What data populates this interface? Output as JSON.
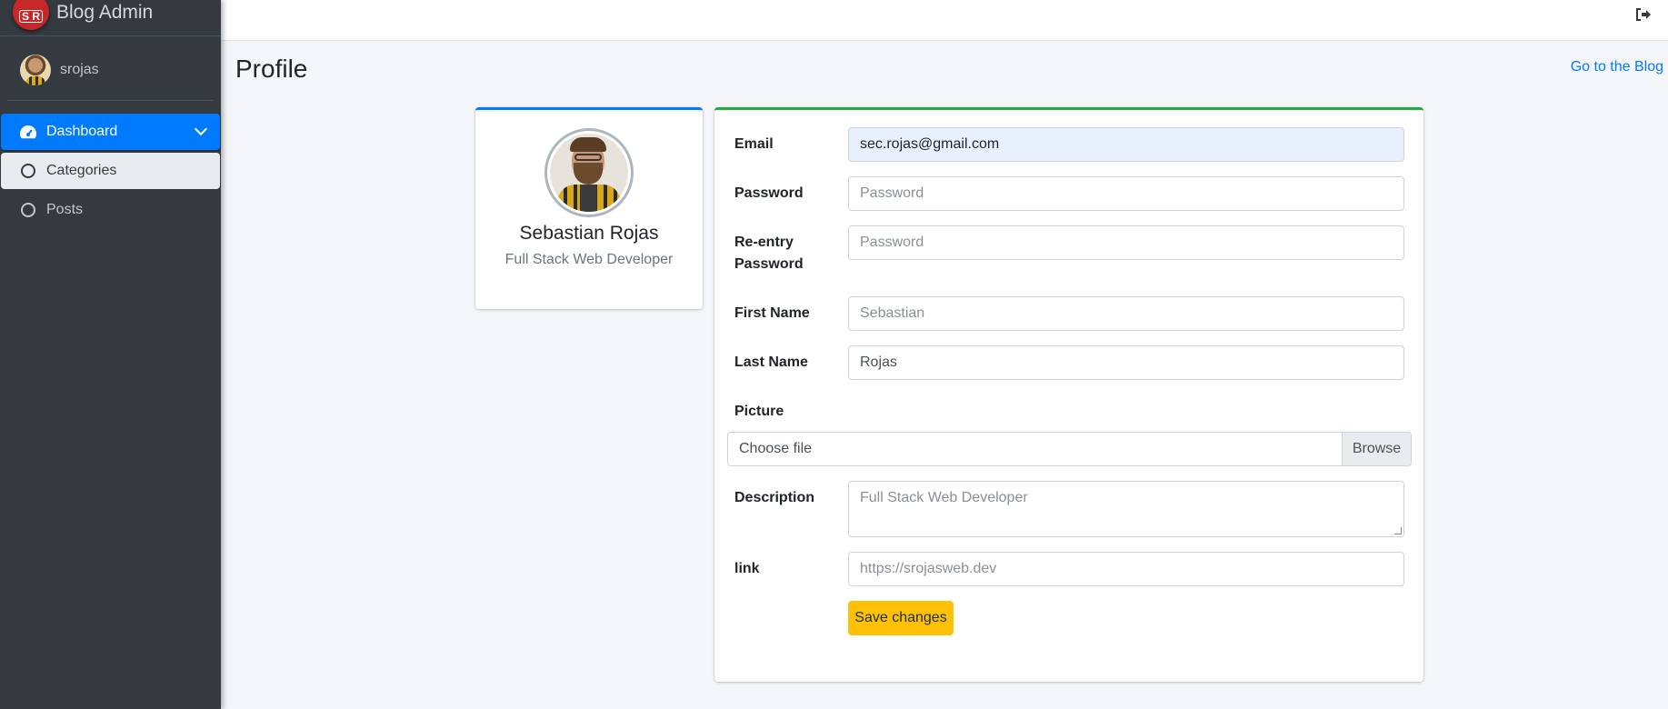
{
  "brand": {
    "logo_text": "S R",
    "title": "Blog Admin"
  },
  "user": {
    "name": "srojas"
  },
  "sidebar": {
    "items": [
      {
        "label": "Dashboard",
        "icon": "tachometer-icon"
      },
      {
        "label": "Categories",
        "icon": "circle-icon"
      },
      {
        "label": "Posts",
        "icon": "circle-icon"
      }
    ]
  },
  "header": {
    "logout_icon": "sign-out-icon"
  },
  "page": {
    "title": "Profile",
    "blog_link": "Go to the Blog"
  },
  "profile": {
    "name": "Sebastian Rojas",
    "role": "Full Stack Web Developer"
  },
  "form": {
    "email_label": "Email",
    "email_value": "sec.rojas@gmail.com",
    "password_label": "Password",
    "password_placeholder": "Password",
    "reentry_label_1": "Re-entry",
    "reentry_label_2": "Password",
    "reentry_placeholder": "Password",
    "first_name_label": "First Name",
    "first_name_placeholder": "Sebastian",
    "last_name_label": "Last Name",
    "last_name_value": "Rojas",
    "picture_label": "Picture",
    "file_placeholder": "Choose file",
    "browse_label": "Browse",
    "description_label": "Description",
    "description_placeholder": "Full Stack Web Developer",
    "link_label": "link",
    "link_placeholder": "https://srojasweb.dev",
    "save_label": "Save changes"
  },
  "colors": {
    "sidebar_bg": "#343a40",
    "primary": "#007bff",
    "success": "#28a745",
    "warning": "#ffc107",
    "content_bg": "#f4f6f9"
  }
}
